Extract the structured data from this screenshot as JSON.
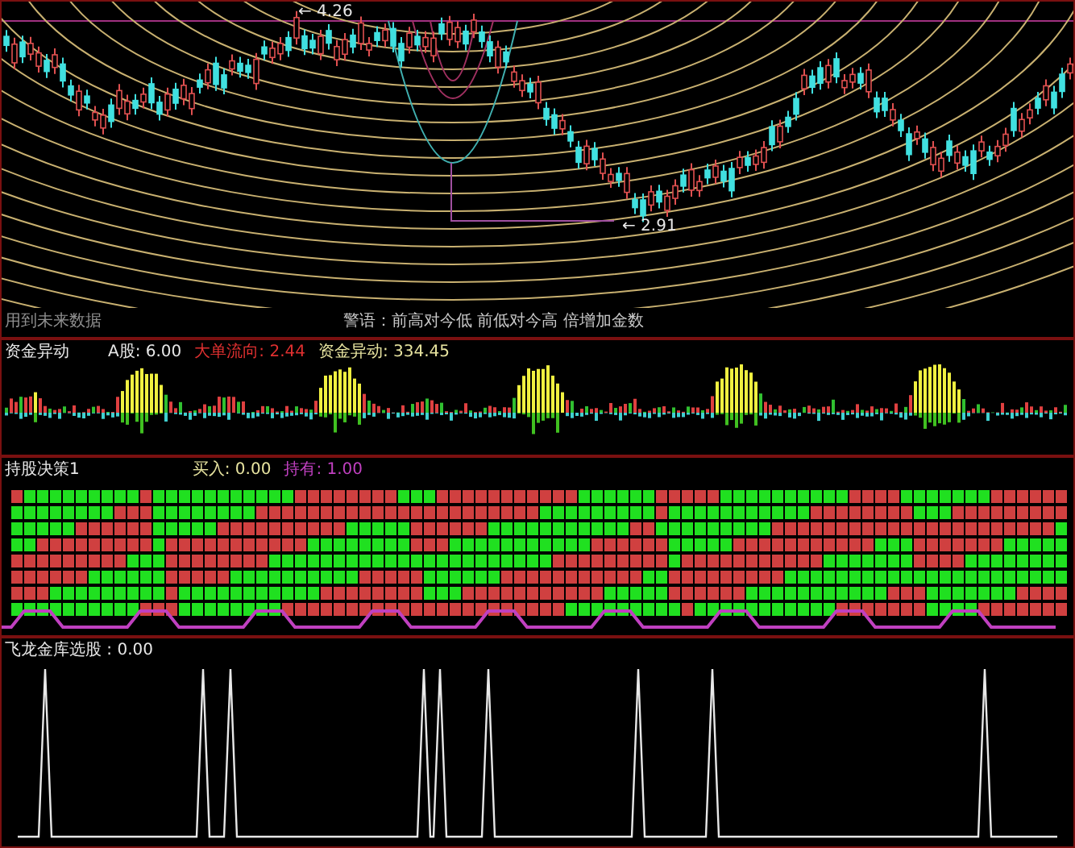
{
  "price_panel": {
    "high_label": "← 4.26",
    "low_label": "← 2.91",
    "future_data_note": "用到未来数据",
    "caption": "警语：前高对今低 前低对今高 倍增加金数"
  },
  "fund_panel": {
    "title": "资金异动",
    "readings": [
      {
        "label": "A股:",
        "value": "6.00",
        "color": "#e8e8e8"
      },
      {
        "label": "大单流向:",
        "value": "2.44",
        "color": "#e03030"
      },
      {
        "label": "资金异动:",
        "value": "334.45",
        "color": "#e8e4a0"
      }
    ]
  },
  "holding_panel": {
    "title": "持股决策1",
    "readings": [
      {
        "label": "买入:",
        "value": "0.00",
        "color": "#e8e4a0"
      },
      {
        "label": "持有:",
        "value": "1.00",
        "color": "#c040c0"
      }
    ]
  },
  "select_panel": {
    "title": "飞龙金库选股 : 0.00"
  }
}
